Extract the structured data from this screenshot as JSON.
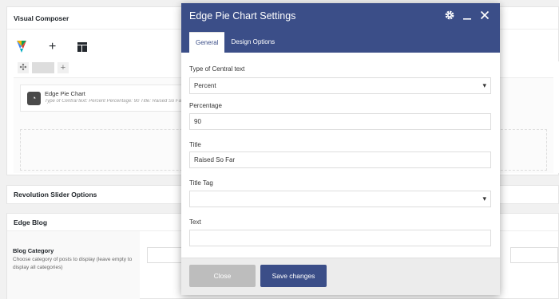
{
  "vc": {
    "title": "Visual Composer",
    "element": {
      "title": "Edge Pie Chart",
      "desc": "Type of Central text: Percent  Percentage: 90  Title: Raised So Far",
      "icon": "pie-chart-icon"
    }
  },
  "rev": {
    "title": "Revolution Slider Options"
  },
  "blog": {
    "title": "Edge Blog",
    "category_label": "Blog Category",
    "category_desc": "Choose category of posts to display (leave empty to display all categories)"
  },
  "modal": {
    "title": "Edge Pie Chart Settings",
    "tabs": [
      {
        "label": "General"
      },
      {
        "label": "Design Options"
      }
    ],
    "fields": {
      "central_text": {
        "label": "Type of Central text",
        "value": "Percent"
      },
      "percentage": {
        "label": "Percentage",
        "value": "90"
      },
      "title": {
        "label": "Title",
        "value": "Raised So Far"
      },
      "title_tag": {
        "label": "Title Tag",
        "value": ""
      },
      "text": {
        "label": "Text",
        "value": ""
      }
    },
    "buttons": {
      "close": "Close",
      "save": "Save changes"
    }
  },
  "colors": {
    "accent": "#3b4e88",
    "close_btn": "#bdbdbd"
  }
}
